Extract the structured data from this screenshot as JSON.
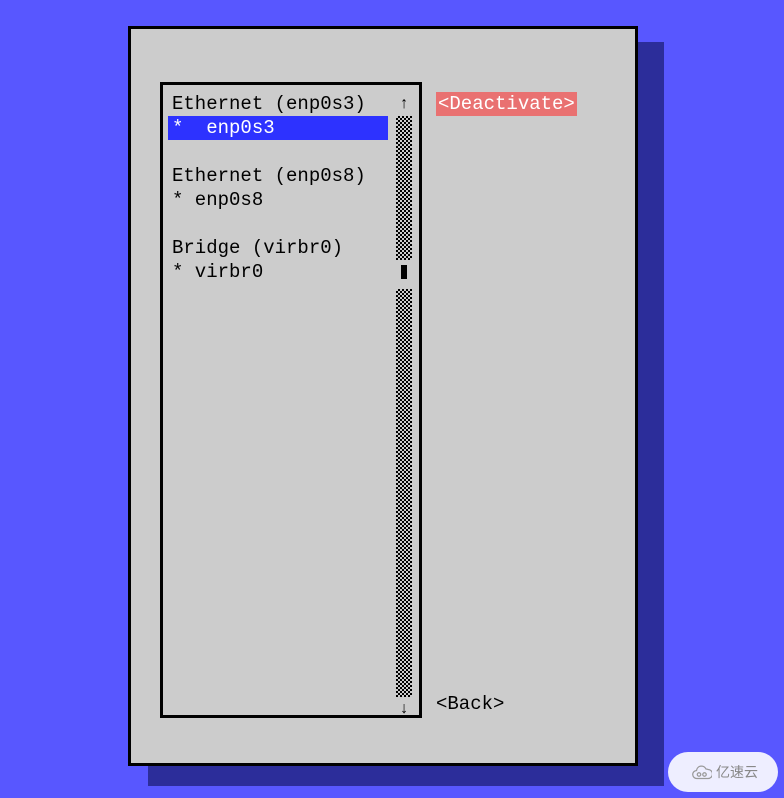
{
  "connections": {
    "groups": [
      {
        "header": "Ethernet (enp0s3)",
        "items": [
          {
            "label": "*  enp0s3",
            "selected": true
          }
        ]
      },
      {
        "header": "Ethernet (enp0s8)",
        "items": [
          {
            "label": "* enp0s8",
            "selected": false
          }
        ]
      },
      {
        "header": "Bridge (virbr0)",
        "items": [
          {
            "label": "* virbr0",
            "selected": false
          }
        ]
      }
    ]
  },
  "buttons": {
    "deactivate": "<Deactivate>",
    "back": "<Back>"
  },
  "scrollbar": {
    "up": "↑",
    "down": "↓",
    "thumb_index": 6,
    "track_rows": 24
  },
  "watermark": "亿速云"
}
